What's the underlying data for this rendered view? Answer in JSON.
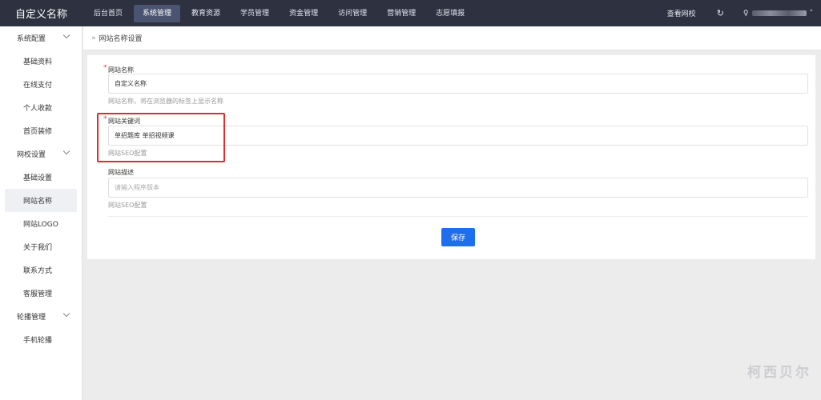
{
  "header": {
    "brand": "自定义名称",
    "nav": [
      {
        "label": "后台首页",
        "active": false
      },
      {
        "label": "系统管理",
        "active": true
      },
      {
        "label": "教育资源",
        "active": false
      },
      {
        "label": "学员管理",
        "active": false
      },
      {
        "label": "资金管理",
        "active": false
      },
      {
        "label": "访问管理",
        "active": false
      },
      {
        "label": "营销管理",
        "active": false
      },
      {
        "label": "志愿填报",
        "active": false
      }
    ],
    "view_school": "查看网校",
    "refresh_icon": "refresh-icon",
    "user_icon": "user-icon"
  },
  "sidebar": {
    "groups": [
      {
        "label": "系统配置",
        "items": [
          "基础资料",
          "在线支付",
          "个人收款",
          "首页装修"
        ]
      },
      {
        "label": "网校设置",
        "items": [
          "基础设置",
          "网站名称",
          "网站LOGO",
          "关于我们",
          "联系方式",
          "客服管理"
        ]
      },
      {
        "label": "轮播管理",
        "items": [
          "手机轮播"
        ]
      }
    ],
    "active_item": "网站名称"
  },
  "breadcrumb": {
    "separator": "»",
    "current": "网站名称设置"
  },
  "form": {
    "site_name": {
      "required_mark": "*",
      "label": "网站名称",
      "value": "自定义名称",
      "help": "网站名称，将在浏览器的标签上显示名称"
    },
    "site_keywords": {
      "required_mark": "*",
      "label": "网站关键词",
      "value": "单招题库 单招视频课",
      "help": "网站SEO配置"
    },
    "site_description": {
      "label": "网站描述",
      "placeholder": "请输入程序版本",
      "help": "网站SEO配置"
    },
    "save_label": "保存"
  },
  "watermark": "柯西贝尔",
  "colors": {
    "topbar": "#2d3140",
    "nav_active": "#4a5470",
    "primary": "#1e6ff0",
    "highlight": "#e42a2a"
  }
}
